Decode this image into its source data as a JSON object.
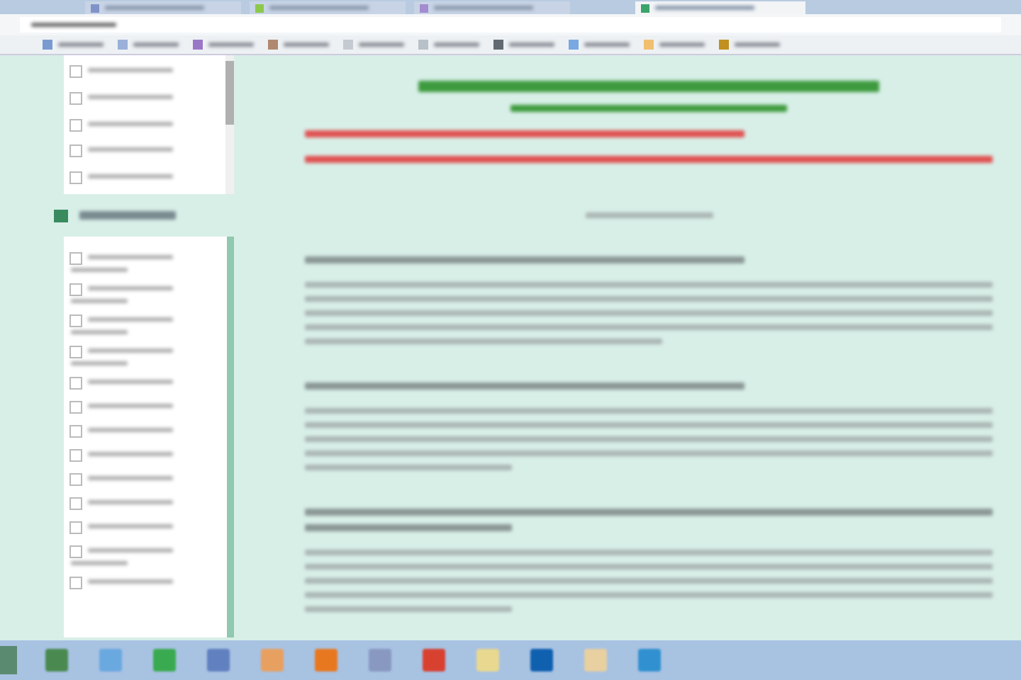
{
  "browser": {
    "tabs": [
      {
        "selected": false,
        "color": "#7f93c8"
      },
      {
        "selected": false,
        "color": "#8cc84a"
      },
      {
        "selected": false,
        "color": "#a58bd0"
      },
      {
        "selected": true,
        "color": "#3aa46a"
      }
    ],
    "bookmarks": [
      {
        "color": "#7a9ad0"
      },
      {
        "color": "#9ab0d8"
      },
      {
        "color": "#9a78c8"
      },
      {
        "color": "#b08870"
      },
      {
        "color": "#c4cad2"
      },
      {
        "color": "#b8c0c8"
      },
      {
        "color": "#606a70"
      },
      {
        "color": "#7aa8e0"
      },
      {
        "color": "#f0c070"
      },
      {
        "color": "#c09020"
      }
    ]
  },
  "sidebar": {
    "top_list": [
      {
        "checked": false
      },
      {
        "checked": false
      },
      {
        "checked": false
      },
      {
        "checked": false
      },
      {
        "checked": false
      }
    ],
    "section": {
      "kind": "heading"
    },
    "list": [
      {
        "checked": false,
        "kind": "two-line"
      },
      {
        "checked": false,
        "kind": "two-line"
      },
      {
        "checked": false,
        "kind": "two-line"
      },
      {
        "checked": false,
        "kind": "two-line"
      },
      {
        "checked": false,
        "kind": "one-line"
      },
      {
        "checked": false,
        "kind": "one-line"
      },
      {
        "checked": false,
        "kind": "one-line"
      },
      {
        "checked": false,
        "kind": "one-line"
      },
      {
        "checked": false,
        "kind": "one-line"
      },
      {
        "checked": false,
        "kind": "one-line"
      },
      {
        "checked": false,
        "kind": "one-line"
      },
      {
        "checked": false,
        "kind": "two-line"
      },
      {
        "checked": false,
        "kind": "one-line"
      }
    ]
  },
  "content": [
    {
      "kind": "title"
    },
    {
      "kind": "subtitle"
    },
    {
      "kind": "alert"
    },
    {
      "kind": "alert"
    },
    {
      "kind": "center-heading"
    },
    {
      "kind": "heading",
      "wrapped": false
    },
    {
      "kind": "paragraph"
    },
    {
      "kind": "heading",
      "wrapped": false
    },
    {
      "kind": "paragraph"
    },
    {
      "kind": "heading",
      "wrapped": true
    },
    {
      "kind": "paragraph"
    }
  ],
  "taskbar": [
    {
      "color": "#4a8a50"
    },
    {
      "color": "#6aa8e0"
    },
    {
      "color": "#3aaa50"
    },
    {
      "color": "#6080c0"
    },
    {
      "color": "#e8a060"
    },
    {
      "color": "#e87820"
    },
    {
      "color": "#8898c0"
    },
    {
      "color": "#d84030"
    },
    {
      "color": "#e8d890"
    },
    {
      "color": "#1060b0"
    },
    {
      "color": "#e8d0a0"
    },
    {
      "color": "#3090d0"
    }
  ]
}
